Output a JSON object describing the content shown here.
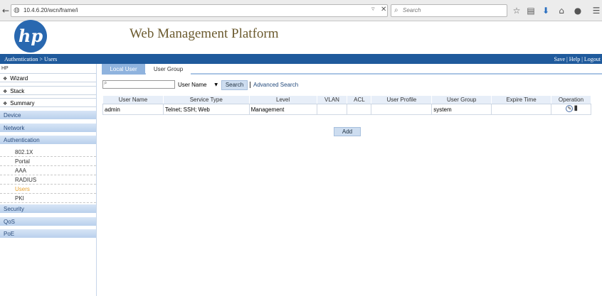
{
  "browser": {
    "url": "10.4.6.20/wcn/frame/i",
    "search_placeholder": "Search"
  },
  "header": {
    "logo_text": "hp",
    "title": "Web Management Platform",
    "breadcrumb": "Authentication > Users",
    "links": [
      "Save",
      "Help",
      "Logout"
    ]
  },
  "sidebar": {
    "root": "HP",
    "top_items": [
      "Wizard",
      "Stack",
      "Summary"
    ],
    "categories": {
      "device": "Device",
      "network": "Network",
      "authentication": "Authentication",
      "security": "Security",
      "qos": "QoS",
      "poe": "PoE"
    },
    "auth_items": [
      "802.1X",
      "Portal",
      "AAA",
      "RADIUS",
      "Users",
      "PKI"
    ],
    "active_item": "Users"
  },
  "tabs": [
    "Local User",
    "User Group"
  ],
  "search": {
    "field_value": "",
    "selected_option": "User Name",
    "button_label": "Search",
    "advanced_label": "Advanced Search"
  },
  "table": {
    "columns": [
      "User Name",
      "Service Type",
      "Level",
      "VLAN",
      "ACL",
      "User Profile",
      "User Group",
      "Expire Time",
      "Operation"
    ],
    "rows": [
      {
        "user_name": "admin",
        "service_type": "Telnet; SSH; Web",
        "level": "Management",
        "vlan": "",
        "acl": "",
        "user_profile": "",
        "user_group": "system",
        "expire_time": ""
      }
    ]
  },
  "add_label": "Add",
  "colors": {
    "brand_blue": "#1f5a9c",
    "tab_active": "#8fb3de",
    "title_text": "#6b5a2e",
    "active_nav": "#e8a02a"
  }
}
